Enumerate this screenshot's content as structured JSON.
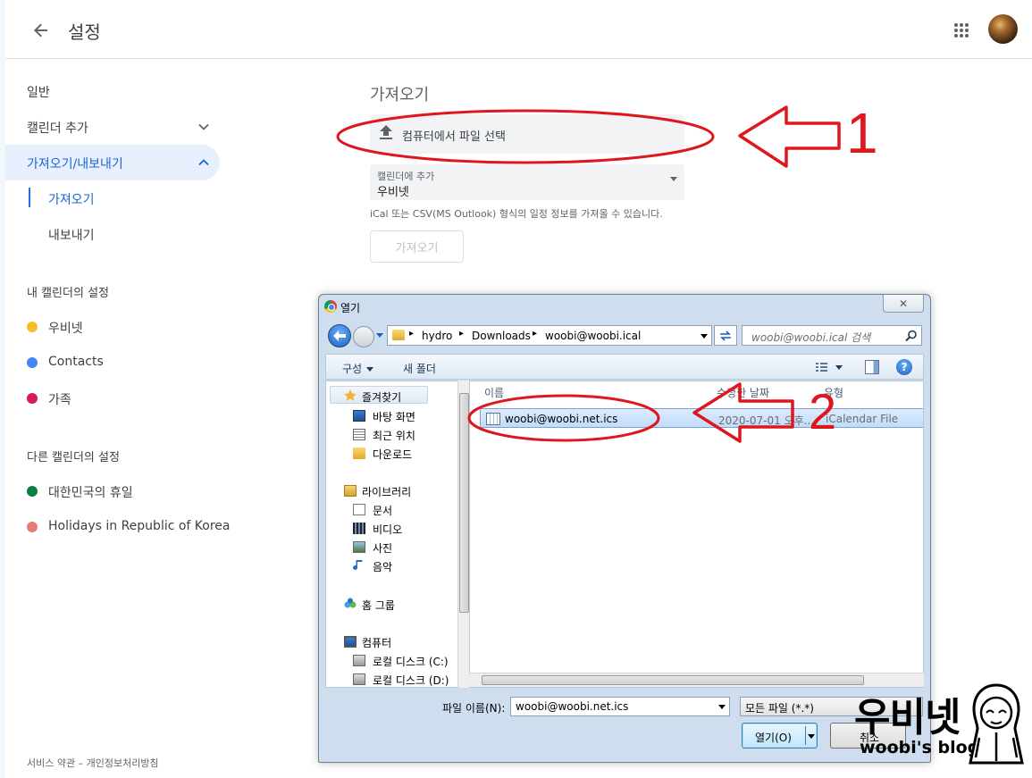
{
  "header": {
    "title": "설정"
  },
  "sidebar": {
    "general": "일반",
    "add_calendar": "캘린더 추가",
    "import_export": "가져오기/내보내기",
    "import": "가져오기",
    "export": "내보내기",
    "my_calendars_heading": "내 캘린더의 설정",
    "my_calendars": [
      {
        "label": "우비넷",
        "color": "#f6bf26"
      },
      {
        "label": "Contacts",
        "color": "#4285f4"
      },
      {
        "label": "가족",
        "color": "#d81b60"
      }
    ],
    "other_calendars_heading": "다른 캘린더의 설정",
    "other_calendars": [
      {
        "label": "대한민국의 휴일",
        "color": "#0b8043"
      },
      {
        "label": "Holidays in Republic of Korea",
        "color": "#e67c73"
      }
    ],
    "footer": "서비스 약관 – 개인정보처리방침"
  },
  "main": {
    "section_title": "가져오기",
    "select_file_label": "컴퓨터에서 파일 선택",
    "add_to_calendar_label": "캘린더에 추가",
    "add_to_calendar_value": "우비넷",
    "helper_text": "iCal 또는 CSV(MS Outlook) 형식의 일정 정보를 가져올 수 있습니다.",
    "import_button": "가져오기"
  },
  "dialog": {
    "title": "열기",
    "close_label": "✕",
    "breadcrumb": [
      "hydro",
      "Downloads",
      "woobi@woobi.ical"
    ],
    "search_placeholder": "woobi@woobi.ical 검색",
    "organize": "구성",
    "new_folder": "새 폴더",
    "help_label": "?",
    "nav_tree": {
      "favorites": "즐겨찾기",
      "favorites_items": [
        "바탕 화면",
        "최근 위치",
        "다운로드"
      ],
      "libraries": "라이브러리",
      "libraries_items": [
        "문서",
        "비디오",
        "사진",
        "음악"
      ],
      "homegroup": "홈 그룹",
      "computer": "컴퓨터",
      "computer_items": [
        "로컬 디스크 (C:)",
        "로컬 디스크 (D:)"
      ]
    },
    "columns": [
      "이름",
      "수정한 날짜",
      "유형"
    ],
    "files": [
      {
        "name": "woobi@woobi.net.ics",
        "date": "2020-07-01 오후...",
        "type": "iCalendar File"
      }
    ],
    "filename_label": "파일 이름(N):",
    "filename_value": "woobi@woobi.net.ics",
    "filter_value": "모든 파일 (*.*)",
    "open_button": "열기(O)",
    "cancel_button": "취소"
  },
  "annotations": {
    "label_1": "1",
    "label_2": "2",
    "accent": "#e0161e"
  },
  "watermark": {
    "title": "우비넷",
    "subtitle": "woobi's blog"
  }
}
